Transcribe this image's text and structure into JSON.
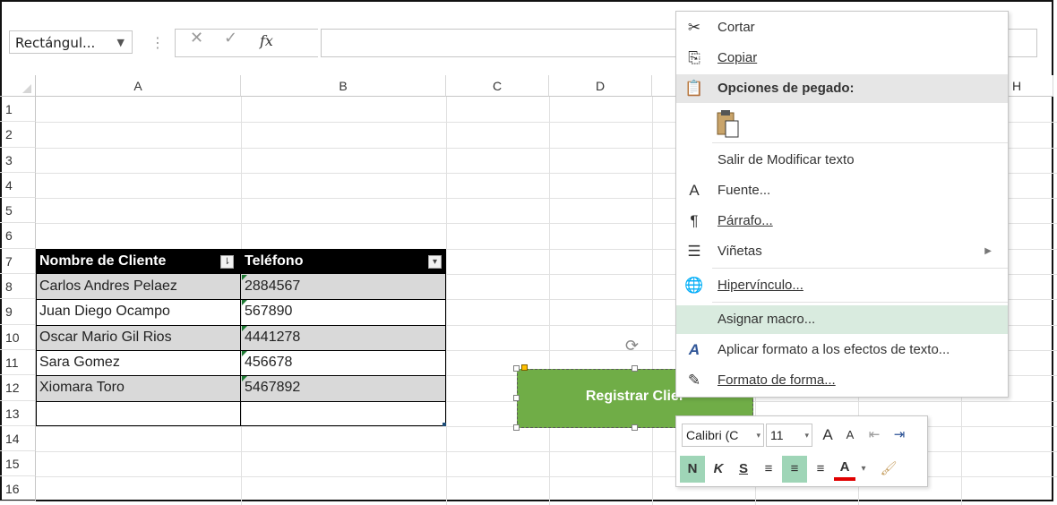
{
  "name_box": {
    "value": "Rectángul...",
    "dropdown_icon": "caret-down-icon"
  },
  "formula_bar": {
    "cancel_icon": "x-icon",
    "enter_icon": "check-icon",
    "fx_label": "fx",
    "value": ""
  },
  "columns": [
    "A",
    "B",
    "C",
    "D",
    "H"
  ],
  "rows": [
    "1",
    "2",
    "3",
    "4",
    "5",
    "6",
    "7",
    "8",
    "9",
    "10",
    "11",
    "12",
    "13",
    "14",
    "15",
    "16"
  ],
  "table": {
    "headers": [
      "Nombre de Cliente",
      "Teléfono"
    ],
    "rows": [
      [
        "Carlos Andres Pelaez",
        "2884567"
      ],
      [
        "Juan Diego Ocampo",
        "567890"
      ],
      [
        "Oscar Mario Gil Rios",
        "4441278"
      ],
      [
        "Sara Gomez",
        "456678"
      ],
      [
        "Xiomara Toro",
        "5467892"
      ]
    ],
    "header_bg": "#000000",
    "band_bg": "#d9d9d9"
  },
  "shape": {
    "text": "Registrar Clier",
    "fill": "#70ad47"
  },
  "context_menu": {
    "cut": "Cortar",
    "copy": "Copiar",
    "paste_options": "Opciones de pegado:",
    "exit_edit": "Salir de Modificar texto",
    "font": "Fuente...",
    "paragraph": "Párrafo...",
    "bullets": "Viñetas",
    "hyperlink": "Hipervínculo...",
    "assign_macro": "Asignar macro...",
    "text_effects": "Aplicar formato a los efectos de texto...",
    "shape_format": "Formato de forma...",
    "font_icon_glyph": "A",
    "hover_color": "#d9ebdf"
  },
  "mini_toolbar": {
    "font_name": "Calibri (C",
    "font_size": "11",
    "bold": "N",
    "italic": "K",
    "underline": "S",
    "font_color_glyph": "A",
    "grow_glyph": "A",
    "shrink_glyph": "A",
    "active_color": "#9fd5b7"
  }
}
